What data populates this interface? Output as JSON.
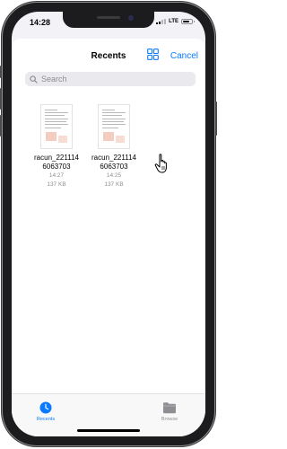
{
  "status_bar": {
    "time": "14:28",
    "network": "LTE",
    "signal_bars": 4,
    "signal_bars_active": 2
  },
  "nav": {
    "title": "Recents",
    "cancel_label": "Cancel",
    "view_toggle_icon": "grid-icon"
  },
  "search": {
    "placeholder": "Search",
    "value": ""
  },
  "files": [
    {
      "name_line1": "racun_221114",
      "name_line2": "6063703",
      "time": "14:27",
      "size": "137 KB"
    },
    {
      "name_line1": "racun_221114",
      "name_line2": "6063703",
      "time": "14:25",
      "size": "137 KB"
    }
  ],
  "tabbar": {
    "tabs": [
      {
        "label": "Recents",
        "icon": "clock-icon",
        "selected": true
      },
      {
        "label": "Browse",
        "icon": "folder-icon",
        "selected": false
      }
    ]
  },
  "colors": {
    "accent": "#0a7aff",
    "inactive": "#8e8e93",
    "device": "#1c1c1e"
  }
}
